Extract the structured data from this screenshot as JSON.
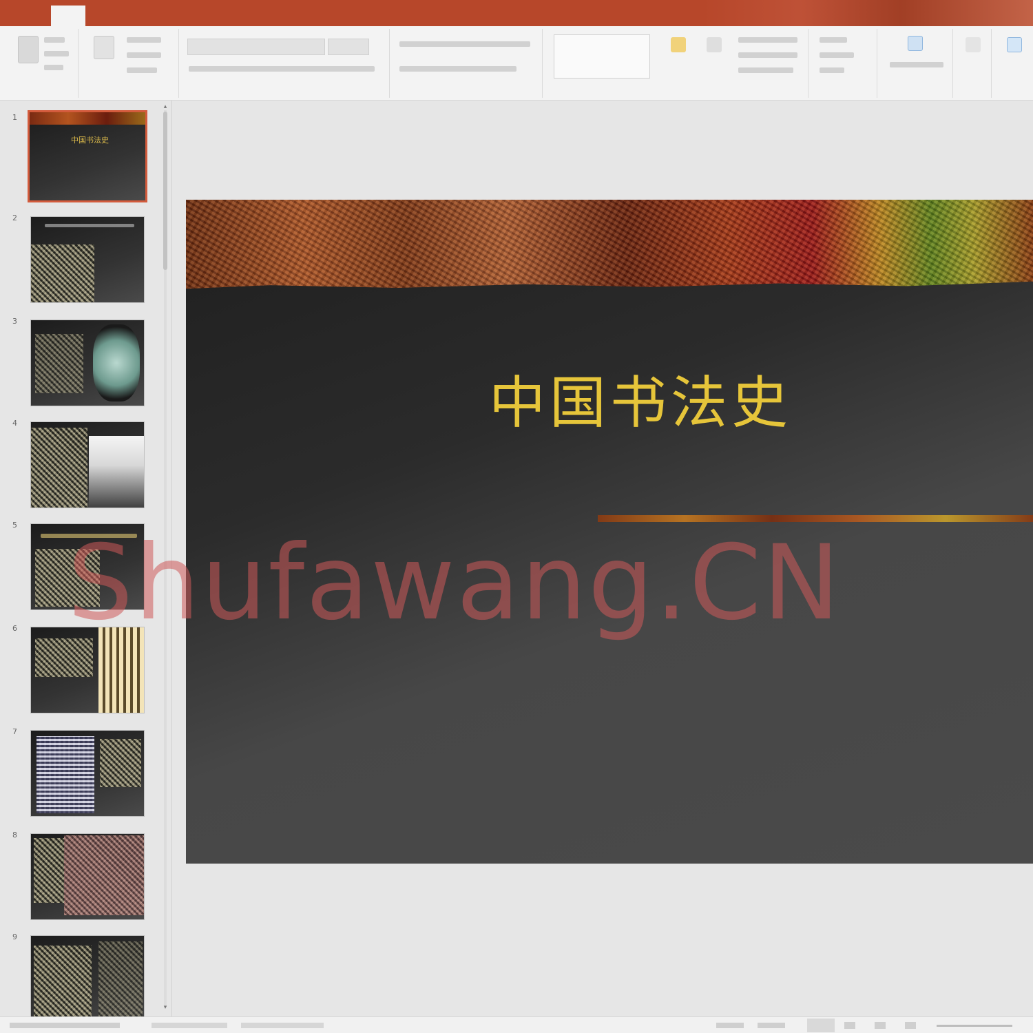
{
  "ribbon": {
    "tabs": [
      "",
      "",
      "",
      "",
      "",
      "",
      "",
      "",
      "",
      "",
      "",
      "",
      "",
      ""
    ]
  },
  "slide": {
    "title": "中国书法史"
  },
  "thumbnails": {
    "selected_index": 1,
    "first_title": "中国书法史"
  },
  "watermark": {
    "text": "Shufawang.CN"
  },
  "colors": {
    "accent": "#b7472a",
    "title_gold": "#e6c53a",
    "slide_bg": "#2b2b2b",
    "watermark": "#cd5a5a"
  }
}
